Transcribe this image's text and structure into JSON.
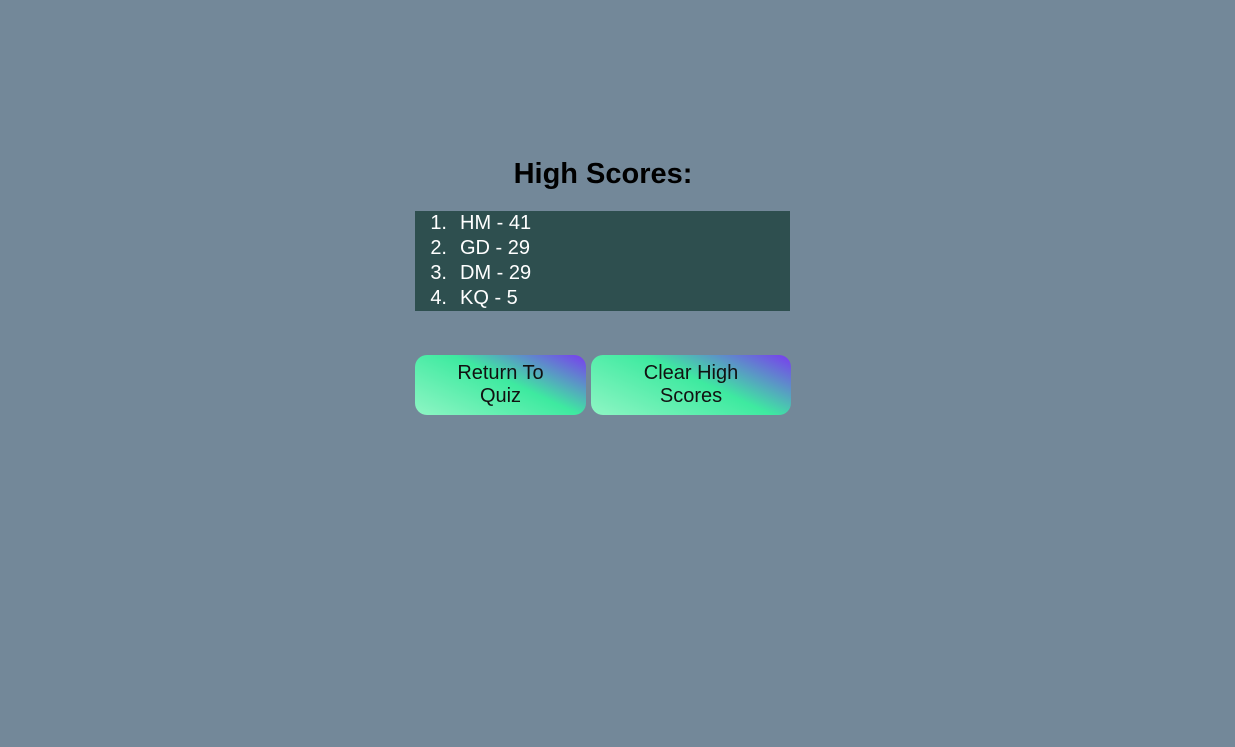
{
  "title": "High Scores:",
  "scores": [
    {
      "rank": "1.",
      "text": "HM - 41"
    },
    {
      "rank": "2.",
      "text": "GD - 29"
    },
    {
      "rank": "3.",
      "text": "DM - 29"
    },
    {
      "rank": "4.",
      "text": "KQ - 5"
    }
  ],
  "buttons": {
    "return_label": "Return To Quiz",
    "clear_label": "Clear High Scores"
  },
  "colors": {
    "background": "#738899",
    "list_background": "#2e4f4f",
    "button_gradient_start": "#8ff5c4",
    "button_gradient_mid": "#3eeaa0",
    "button_gradient_end": "#7a3af0"
  }
}
